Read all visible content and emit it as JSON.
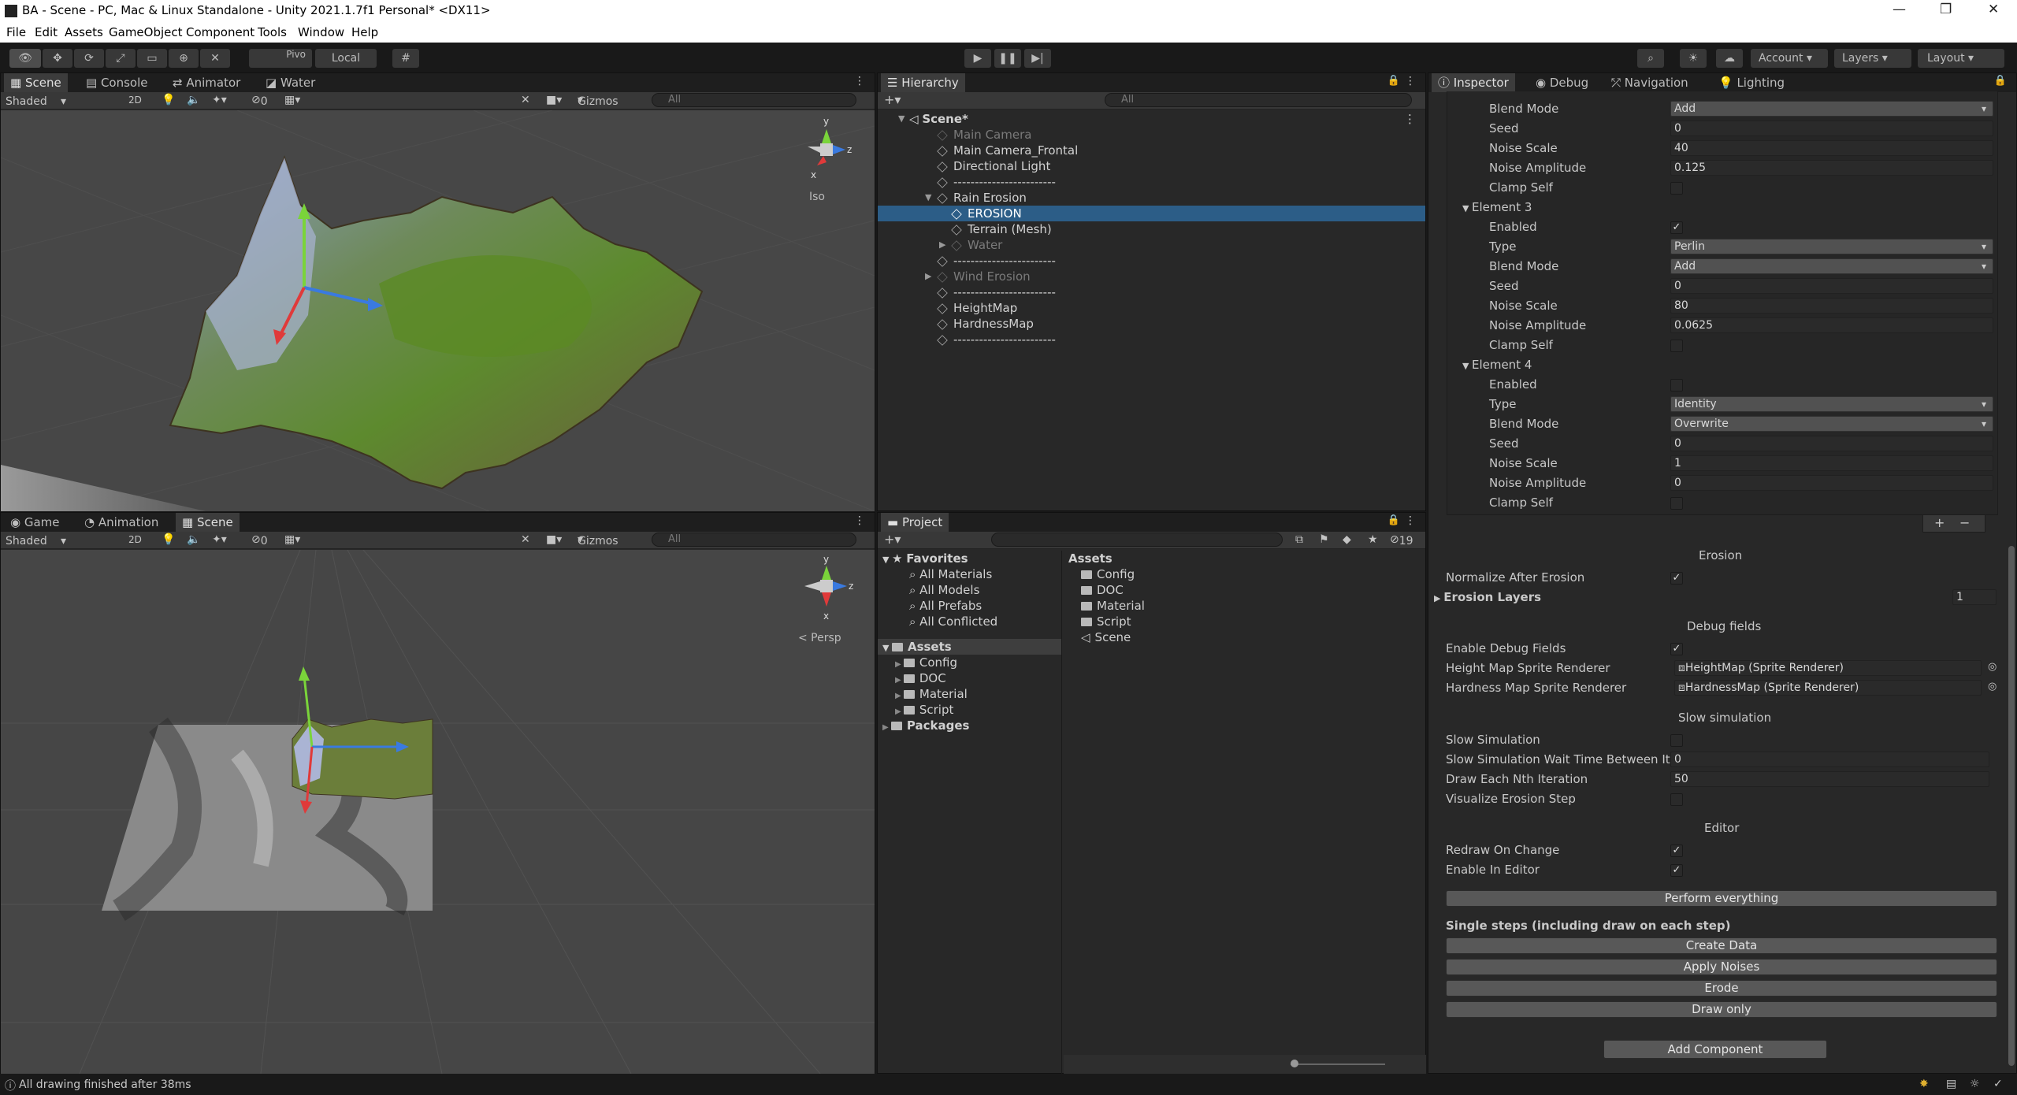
{
  "window": {
    "title": "BA - Scene - PC, Mac & Linux Standalone - Unity 2021.1.7f1 Personal* <DX11>",
    "controls": [
      "—",
      "❐",
      "✕"
    ]
  },
  "menu": [
    "File",
    "Edit",
    "Assets",
    "GameObject",
    "Component",
    "Tools",
    "Window",
    "Help"
  ],
  "toolbar": {
    "pivot": "Pivo",
    "local": "Local",
    "account": "Account",
    "layers": "Layers",
    "layout": "Layout"
  },
  "scene_panel": {
    "tabs": [
      "Scene",
      "Console",
      "Animator",
      "Water"
    ],
    "shading": "Shaded",
    "mode_2d": "2D",
    "hidden_count": "0",
    "gizmos": "Gizmos",
    "search_placeholder": "All",
    "projection": "Iso"
  },
  "game_panel": {
    "tabs": [
      "Game",
      "Animation",
      "Scene"
    ],
    "shading": "Shaded",
    "mode_2d": "2D",
    "hidden_count": "0",
    "gizmos": "Gizmos",
    "search_placeholder": "All",
    "projection": "< Persp"
  },
  "hierarchy": {
    "tab": "Hierarchy",
    "search_placeholder": "All",
    "scene": "Scene*",
    "items": [
      {
        "label": "Main Camera",
        "state": "dim"
      },
      {
        "label": "Main Camera_Frontal",
        "state": "normal"
      },
      {
        "label": "Directional Light",
        "state": "normal"
      },
      {
        "label": "------------------------",
        "state": "normal"
      },
      {
        "label": "Rain Erosion",
        "state": "normal"
      },
      {
        "label": "EROSION",
        "state": "selected"
      },
      {
        "label": "Terrain (Mesh)",
        "state": "normal"
      },
      {
        "label": "Water",
        "state": "dim"
      },
      {
        "label": "------------------------",
        "state": "normal"
      },
      {
        "label": "Wind Erosion",
        "state": "dim"
      },
      {
        "label": "------------------------",
        "state": "normal"
      },
      {
        "label": "HeightMap",
        "state": "normal"
      },
      {
        "label": "HardnessMap",
        "state": "normal"
      },
      {
        "label": "------------------------",
        "state": "normal"
      }
    ]
  },
  "project": {
    "tab": "Project",
    "hidden_count": "19",
    "favorites_label": "Favorites",
    "favorites": [
      "All Materials",
      "All Models",
      "All Prefabs",
      "All Conflicted"
    ],
    "assets_label": "Assets",
    "assets": [
      "Config",
      "DOC",
      "Material",
      "Script"
    ],
    "packages_label": "Packages",
    "content_header": "Assets",
    "content": [
      "Config",
      "DOC",
      "Material",
      "Script",
      "Scene"
    ]
  },
  "inspector": {
    "tabs": [
      "Inspector",
      "Debug",
      "Navigation",
      "Lighting"
    ],
    "top_rows": [
      {
        "label": "Blend Mode",
        "value": "Add",
        "kind": "dropdown"
      },
      {
        "label": "Seed",
        "value": "0",
        "kind": "field"
      },
      {
        "label": "Noise Scale",
        "value": "40",
        "kind": "field"
      },
      {
        "label": "Noise Amplitude",
        "value": "0.125",
        "kind": "field"
      },
      {
        "label": "Clamp Self",
        "value": "",
        "kind": "check"
      }
    ],
    "element3": {
      "label": "Element 3",
      "rows": [
        {
          "label": "Enabled",
          "value": "✓",
          "kind": "check"
        },
        {
          "label": "Type",
          "value": "Perlin",
          "kind": "dropdown"
        },
        {
          "label": "Blend Mode",
          "value": "Add",
          "kind": "dropdown"
        },
        {
          "label": "Seed",
          "value": "0",
          "kind": "field"
        },
        {
          "label": "Noise Scale",
          "value": "80",
          "kind": "field"
        },
        {
          "label": "Noise Amplitude",
          "value": "0.0625",
          "kind": "field"
        },
        {
          "label": "Clamp Self",
          "value": "",
          "kind": "check"
        }
      ]
    },
    "element4": {
      "label": "Element 4",
      "rows": [
        {
          "label": "Enabled",
          "value": "",
          "kind": "check"
        },
        {
          "label": "Type",
          "value": "Identity",
          "kind": "dropdown"
        },
        {
          "label": "Blend Mode",
          "value": "Overwrite",
          "kind": "dropdown"
        },
        {
          "label": "Seed",
          "value": "0",
          "kind": "field"
        },
        {
          "label": "Noise Scale",
          "value": "1",
          "kind": "field"
        },
        {
          "label": "Noise Amplitude",
          "value": "0",
          "kind": "field"
        },
        {
          "label": "Clamp Self",
          "value": "",
          "kind": "check"
        }
      ]
    },
    "list_add": "+",
    "list_remove": "−",
    "erosion_header": "Erosion",
    "normalize_after_erosion": {
      "label": "Normalize After Erosion",
      "value": "✓"
    },
    "erosion_layers": {
      "label": "Erosion Layers",
      "value": "1"
    },
    "debug_header": "Debug fields",
    "enable_debug_fields": {
      "label": "Enable Debug Fields",
      "value": "✓"
    },
    "height_map_sprite": {
      "label": "Height Map Sprite Renderer",
      "value": "HeightMap (Sprite Renderer)"
    },
    "hardness_map_sprite": {
      "label": "Hardness Map Sprite Renderer",
      "value": "HardnessMap (Sprite Renderer)"
    },
    "slow_header": "Slow simulation",
    "slow_simulation": {
      "label": "Slow Simulation",
      "value": ""
    },
    "slow_wait": {
      "label": "Slow Simulation Wait Time Between Iter",
      "value": "0"
    },
    "draw_each": {
      "label": "Draw Each Nth Iteration",
      "value": "50"
    },
    "visualize_step": {
      "label": "Visualize Erosion Step",
      "value": ""
    },
    "editor_header": "Editor",
    "redraw_on_change": {
      "label": "Redraw On Change",
      "value": "✓"
    },
    "enable_in_editor": {
      "label": "Enable In Editor",
      "value": "✓"
    },
    "perform_everything": "Perform everything",
    "single_steps_header": "Single steps (including draw on each step)",
    "create_data": "Create Data",
    "apply_noises": "Apply Noises",
    "erode": "Erode",
    "draw_only": "Draw only",
    "add_component": "Add Component"
  },
  "status": {
    "message": "All drawing finished after 38ms"
  },
  "colors": {
    "selection": "#2c5d87",
    "panel": "#282828",
    "viewport": "#474747"
  }
}
